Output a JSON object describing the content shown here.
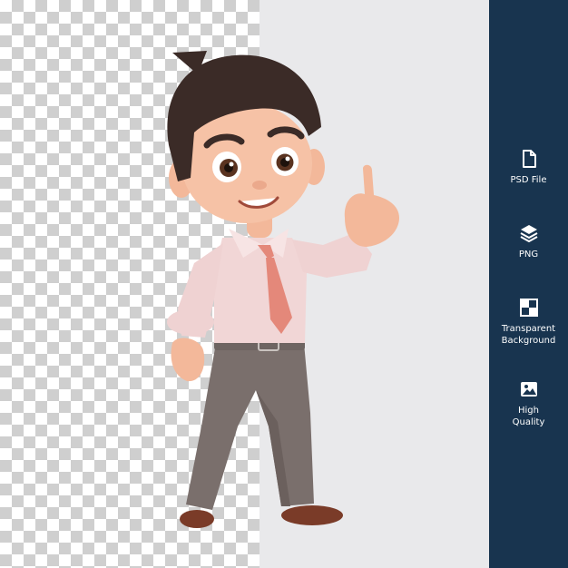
{
  "colors": {
    "sidebar_bg": "#18344f",
    "plain_bg": "#e9e9eb",
    "checker_dark": "#cfcfcf",
    "checker_light": "#ffffff"
  },
  "features": [
    {
      "icon": "file-icon",
      "label": "PSD File"
    },
    {
      "icon": "layers-icon",
      "label": "PNG"
    },
    {
      "icon": "checkerboard-icon",
      "label": "Transparent\nBackground"
    },
    {
      "icon": "image-icon",
      "label": "High\nQuality"
    }
  ]
}
